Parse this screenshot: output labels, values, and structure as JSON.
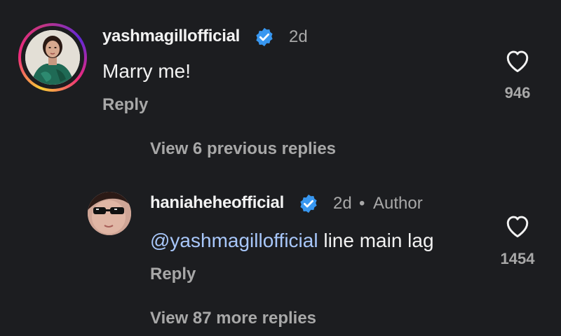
{
  "colors": {
    "background": "#1c1d20",
    "text": "#f2f2f2",
    "secondary": "#a8a8a8",
    "mention": "#a8c7fa",
    "verified": "#3897f0"
  },
  "comment": {
    "username": "yashmagillofficial",
    "time": "2d",
    "text": "Marry me!",
    "reply_label": "Reply",
    "like_count": "946",
    "like_icon": "heart-outline-icon",
    "verified_icon": "verified-badge-icon"
  },
  "view_previous": "View 6 previous replies",
  "reply": {
    "username": "haniaheheofficial",
    "time": "2d",
    "separator": "•",
    "author_label": "Author",
    "mention": "@yashmagillofficial",
    "text": " line main lag",
    "reply_label": "Reply",
    "like_count": "1454",
    "like_icon": "heart-outline-icon",
    "verified_icon": "verified-badge-icon"
  },
  "view_more": "View 87 more replies"
}
